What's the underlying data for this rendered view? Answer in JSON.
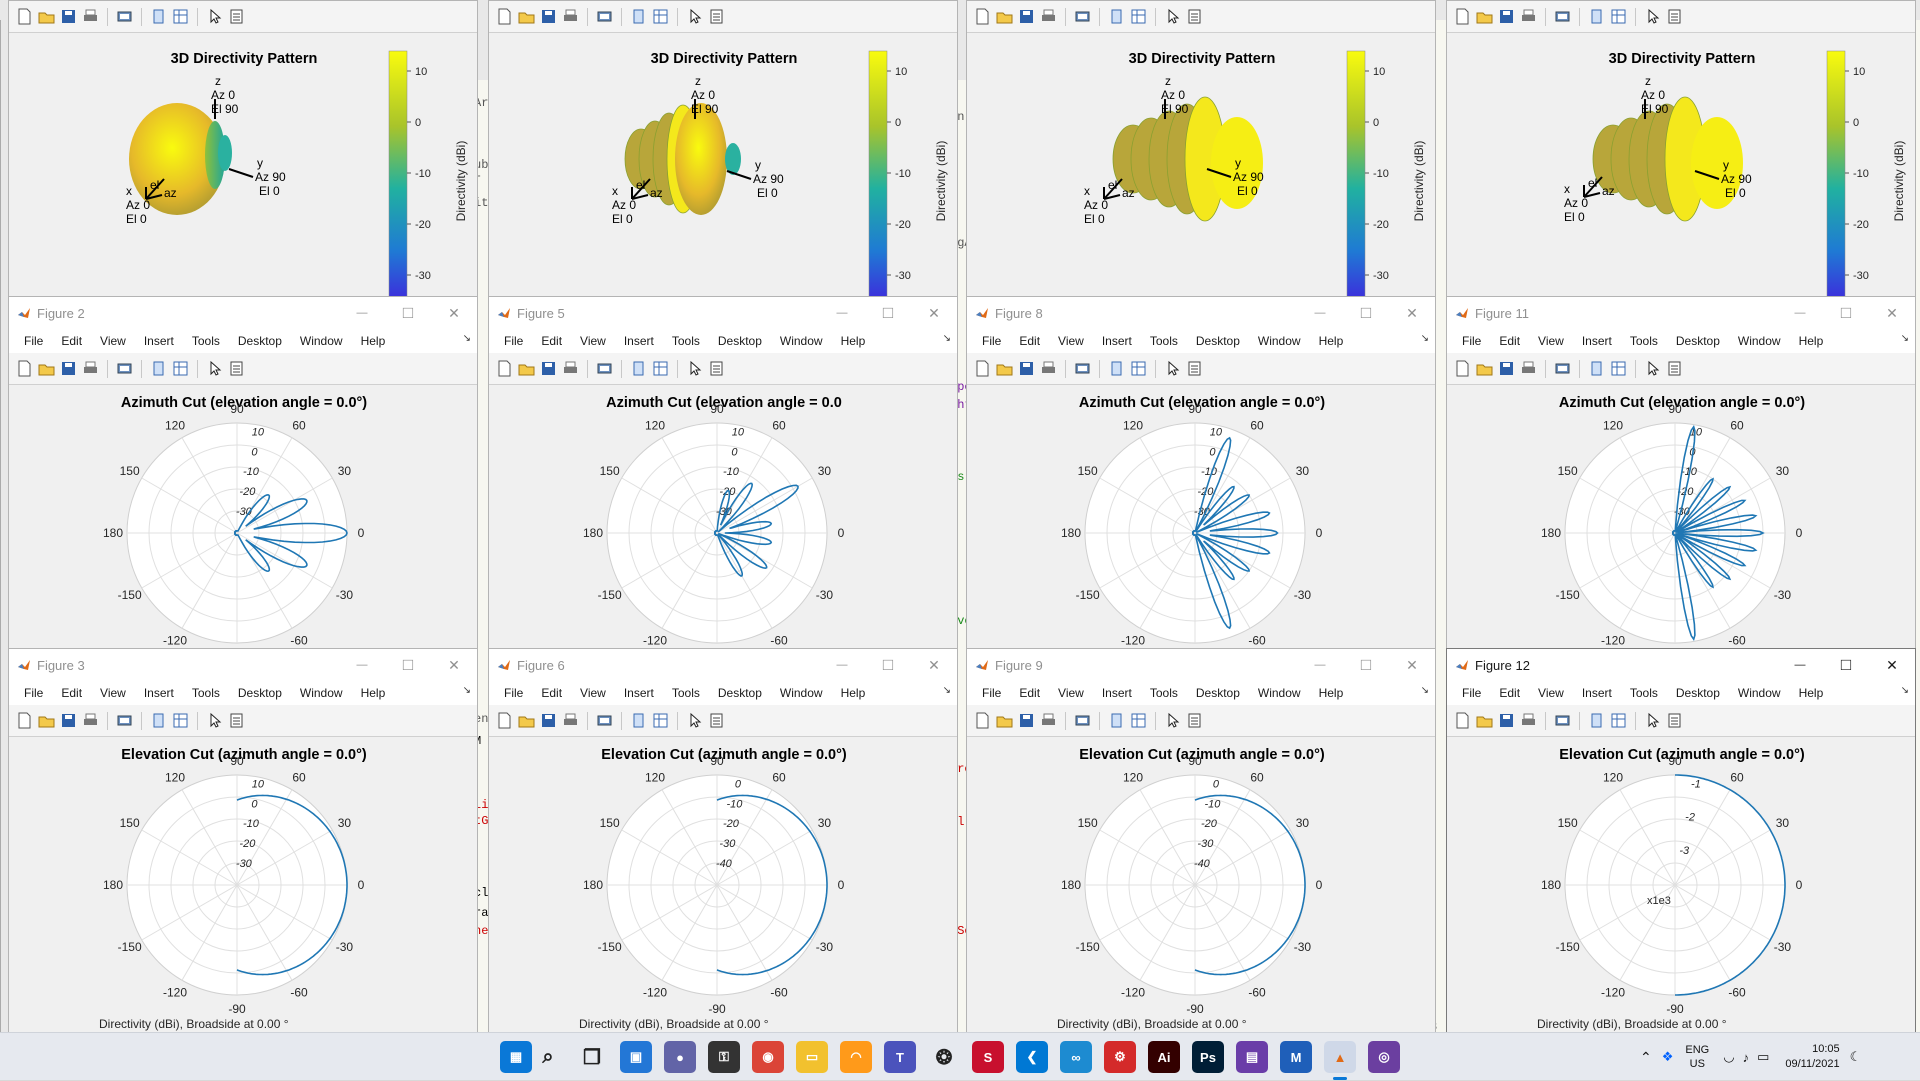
{
  "menu": [
    "File",
    "Edit",
    "View",
    "Insert",
    "Tools",
    "Desktop",
    "Window",
    "Help"
  ],
  "columns": [
    {
      "top": {
        "title": "3D Directivity Pattern"
      },
      "mid": {
        "window_title": "Figure 2",
        "plot_title": "Azimuth Cut (elevation angle = 0.0°)"
      },
      "bottom": {
        "window_title": "Figure 3",
        "plot_title": "Elevation Cut (azimuth angle = 0.0°)"
      }
    },
    {
      "top": {
        "title": "3D Directivity Pattern"
      },
      "mid": {
        "window_title": "Figure 5",
        "plot_title": "Azimuth Cut (elevation angle = 0.0"
      },
      "bottom": {
        "window_title": "Figure 6",
        "plot_title": "Elevation Cut (azimuth angle = 0.0°)"
      }
    },
    {
      "top": {
        "title": "3D Directivity Pattern"
      },
      "mid": {
        "window_title": "Figure 8",
        "plot_title": "Azimuth Cut (elevation angle = 0.0°)"
      },
      "bottom": {
        "window_title": "Figure 9",
        "plot_title": "Elevation Cut (azimuth angle = 0.0°)"
      }
    },
    {
      "top": {
        "title": "3D Directivity Pattern"
      },
      "mid": {
        "window_title": "Figure 11",
        "plot_title": "Azimuth Cut (elevation angle = 0.0°)"
      },
      "bottom": {
        "window_title": "Figure 12",
        "plot_title": "Elevation Cut (azimuth angle = 0.0°)"
      }
    }
  ],
  "axes3d": {
    "z": "z",
    "z_az": "Az 0",
    "z_el": "El 90",
    "y": "y",
    "y_az": "Az 90",
    "y_el": "El 0",
    "x": "x",
    "x_az": "Az 0",
    "x_el": "El 0",
    "az": "az",
    "el": "el"
  },
  "colorbar": {
    "label": "Directivity (dBi)",
    "ticks_a": [
      "10",
      "0",
      "-10",
      "-20",
      "-30"
    ],
    "ticks_b": [
      "10",
      "0",
      "-10",
      "-20",
      "-30"
    ]
  },
  "polar_angles": [
    "90",
    "60",
    "30",
    "0",
    "-30",
    "-60",
    "-90",
    "-120",
    "-150",
    "180",
    "150",
    "120"
  ],
  "radial_labels": {
    "az_1": [
      "10",
      "0",
      "-10",
      "-20",
      "-30"
    ],
    "az_2": [
      "10",
      "0",
      "-10",
      "-20",
      "-30"
    ],
    "az_3": [
      "10",
      "0",
      "-10",
      "-20",
      "-30"
    ],
    "az_4": [
      "10",
      "0",
      "-10",
      "-20",
      "-30"
    ],
    "el_1": [
      "10",
      "0",
      "-10",
      "-20",
      "-30"
    ],
    "el_2": [
      "0",
      "-10",
      "-20",
      "-30",
      "-40"
    ],
    "el_3": [
      "0",
      "-10",
      "-20",
      "-30",
      "-40"
    ],
    "el_4": [
      "-1",
      "-2",
      "-3"
    ]
  },
  "el_4_exponent": "x1e3",
  "cut_off_label": "Directivity (dBi), Broadside at 0.00 °",
  "background_code": [
    "Ar",
    "on",
    "ub",
    "r -",
    "itl",
    "ngA",
    "Spe",
    "ght",
    "es",
    "nve",
    "end",
    "M",
    "Li",
    "tG",
    "Pro",
    "cl",
    "cl",
    "ra",
    "ner",
    "ISe",
    "8"
  ],
  "taskbar": {
    "apps": [
      "windows-start",
      "search",
      "task-view",
      "widgets",
      "chat",
      "security",
      "chrome",
      "file-explorer",
      "arc",
      "teams",
      "openai",
      "solidworks",
      "vscode",
      "app-blue",
      "app-red",
      "illustrator",
      "photoshop",
      "app-purple",
      "app-m",
      "matlab",
      "github"
    ],
    "sw_label": "S.W\n2020",
    "ai_label": "Ai",
    "ps_label": "Ps",
    "lang_top": "ENG",
    "lang_bottom": "US",
    "time": "10:05",
    "date": "09/11/2021"
  },
  "colors": {
    "trace": "#1f77b4",
    "matlab_orange": "#e16a16",
    "parula_top": "#f9fb0e",
    "parula_mid": "#21b1a0",
    "parula_bottom": "#352a87"
  }
}
